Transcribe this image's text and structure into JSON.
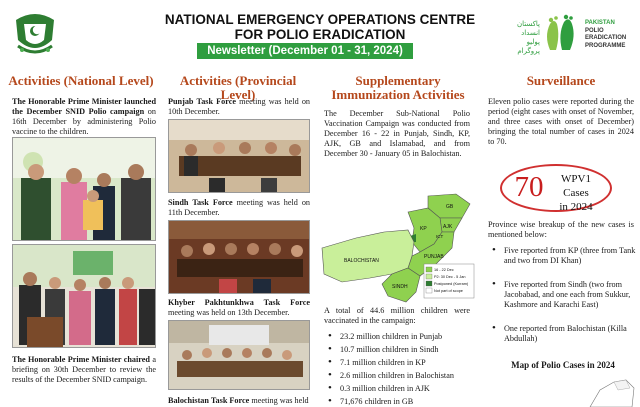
{
  "header": {
    "title_line1": "NATIONAL EMERGENCY OPERATIONS CENTRE",
    "title_line2": "FOR POLIO ERADICATION",
    "newsletter": "Newsletter (December 01 - 31, 2024)",
    "urdu_l1": "پاکستان",
    "urdu_l2": "انسداد",
    "urdu_l3": "پولیو",
    "urdu_l4": "پروگرام",
    "prog_l1": "PAKISTAN",
    "prog_l2": "POLIO",
    "prog_l3": "ERADICATION",
    "prog_l4": "PROGRAMME"
  },
  "col1": {
    "heading": "Activities (National Level)",
    "p1_bold": "The Honorable Prime Minister launched the December SNID Polio campaign",
    "p1_rest": " on 16th December by administering Polio vaccine to the children.",
    "p2_bold": "The Honorable Prime Minister chaired",
    "p2_rest": " a briefing on 30th December to review the results of the December SNID campaign."
  },
  "col2": {
    "heading": "Activities (Provincial Level)",
    "punjab_bold": "Punjab Task Force",
    "punjab_rest": " meeting was held on 10th December.",
    "sindh_bold": "Sindh Task Force",
    "sindh_rest": " meeting was held on 11th December.",
    "kp_bold": "Khyber Pakhtunkhwa Task Force",
    "kp_rest": " meeting was held on 13th December.",
    "bal_bold": "Balochistan Task Force",
    "bal_rest": " meeting was held"
  },
  "col3": {
    "heading_l1": "Supplementary",
    "heading_l2": "Immunization Activities",
    "p1": "The December Sub-National Polio Vaccination Campaign was conducted from December 16 - 22 in Punjab, Sindh, KP, AJK, GB and Islamabad, and from December 30 - January 05 in Balochistan.",
    "map_labels": {
      "gb": "GB",
      "ajk": "AJK",
      "ict": "ICT",
      "kp": "KP",
      "punjab": "PUNJAB",
      "balochistan": "BALOCHISTAN",
      "sindh": "SINDH"
    },
    "legend": [
      {
        "label": "16 - 22 Dec",
        "color": "#8fd14f"
      },
      {
        "label": "P2: 30 Dec - 5 Jan",
        "color": "#c9ef9a"
      },
      {
        "label": "Postponed (Kurram)",
        "color": "#2e7d32"
      },
      {
        "label": "Not part of scope",
        "color": "#ffffff"
      }
    ],
    "p2": "A total of 44.6 million children were vaccinated in the campaign:",
    "bullets": [
      "23.2 million children in Punjab",
      "10.7 million children in Sindh",
      "7.1 million children in KP",
      "2.6 million children in Balochistan",
      "0.3 million children in AJK",
      "71,676 children in GB"
    ]
  },
  "col4": {
    "heading": "Surveillance",
    "p1": "Eleven polio cases were reported during the period (eight cases with onset of November, and three cases with onset of December) bringing the total number of cases in 2024 to 70.",
    "case_number": "70",
    "case_label_l1": "WPV1 Cases",
    "case_label_l2": "in 2024",
    "p2": "Province wise breakup of the new cases is mentioned below:",
    "bullets": [
      "Five reported from KP (three from Tank and two from DI Khan)",
      "Five reported from Sindh (two from Jacobabad, and one each from Sukkur, Kashmore and Karachi East)",
      "One reported from Balochistan (Killa Abdullah)"
    ],
    "map_title": "Map of Polio Cases in 2024"
  },
  "colors": {
    "accent_orange": "#b5481c",
    "newsletter_green": "#2f9e3f",
    "case_red": "#c81e1e"
  }
}
